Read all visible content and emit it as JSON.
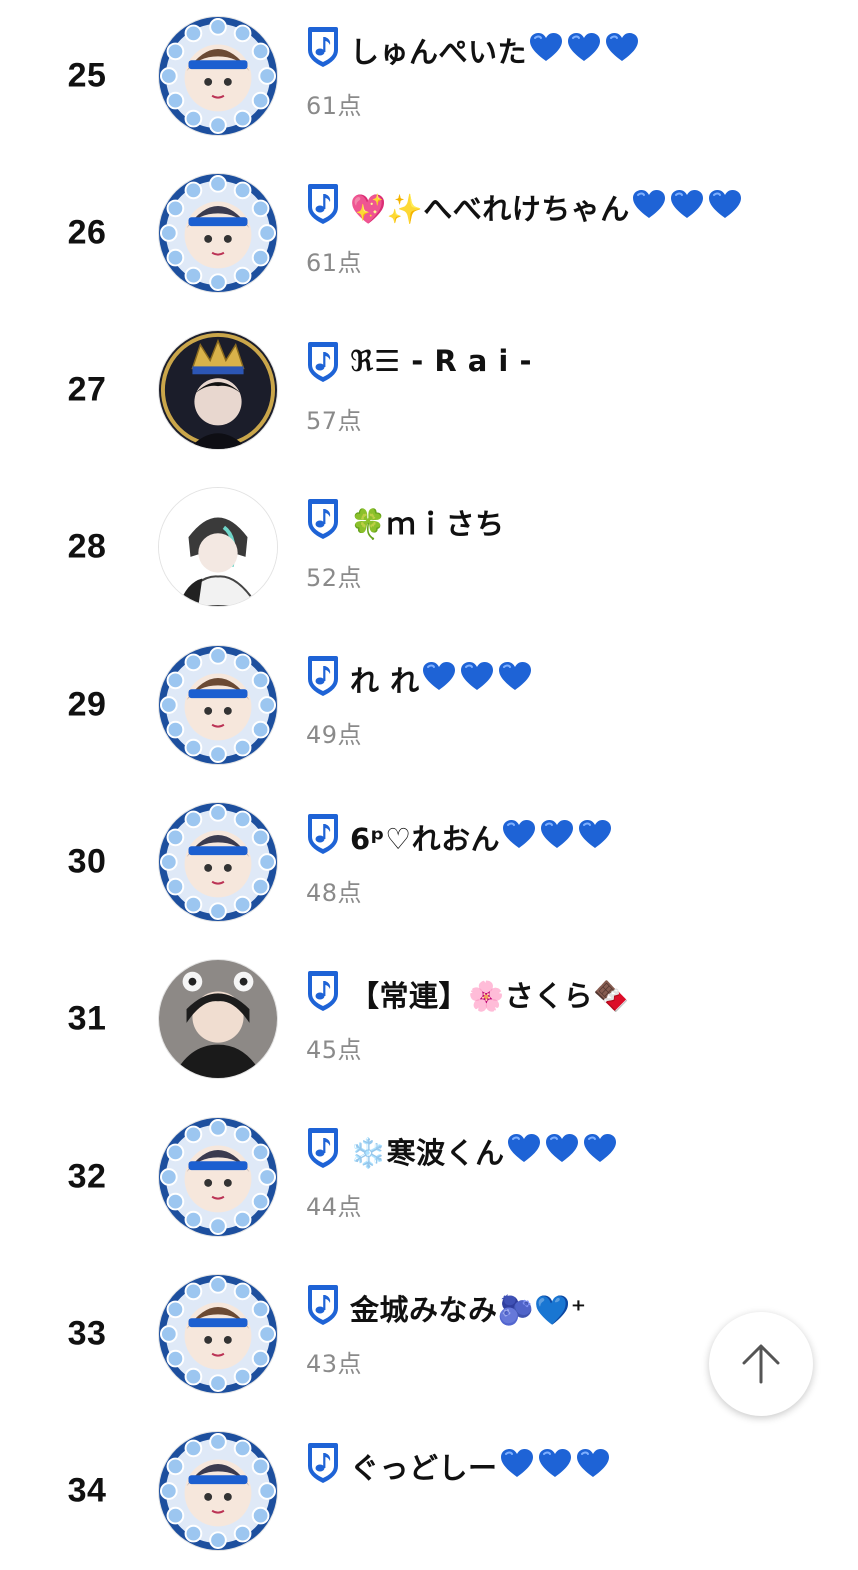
{
  "ranking": [
    {
      "rank": "25",
      "name": "しゅんぺいた",
      "score": "61点",
      "hearts": 3,
      "avatar": "blue-wreath"
    },
    {
      "rank": "26",
      "name": "💖✨へべれけちゃん",
      "score": "61点",
      "hearts": 3,
      "avatar": "blue-wreath"
    },
    {
      "rank": "27",
      "name": "ℜ☰ - R a i -",
      "score": "57点",
      "hearts": 0,
      "avatar": "crown-dark"
    },
    {
      "rank": "28",
      "name": "🍀ｍｉさち",
      "score": "52点",
      "hearts": 0,
      "avatar": "plain"
    },
    {
      "rank": "29",
      "name": "れ れ",
      "score": "49点",
      "hearts": 3,
      "avatar": "blue-wreath"
    },
    {
      "rank": "30",
      "name": "6ᵖ♡れおん",
      "score": "48点",
      "hearts": 3,
      "avatar": "blue-wreath"
    },
    {
      "rank": "31",
      "name": "【常連】🌸さくら🍫",
      "score": "45点",
      "hearts": 0,
      "avatar": "photo"
    },
    {
      "rank": "32",
      "name": "❄️寒波くん",
      "score": "44点",
      "hearts": 3,
      "avatar": "blue-wreath"
    },
    {
      "rank": "33",
      "name": "金城みなみ🫐💙⁺",
      "score": "43点",
      "hearts": 0,
      "avatar": "blue-wreath"
    },
    {
      "rank": "34",
      "name": "ぐっどしー",
      "score": "",
      "hearts": 3,
      "avatar": "blue-wreath"
    }
  ],
  "colors": {
    "badge": "#1e63d6",
    "heart": "#1e63d6",
    "score": "#8a8a8a"
  },
  "icons": {
    "badge": "music-note-shield-icon",
    "heart": "blue-heart-icon",
    "scroll_top": "arrow-up-icon"
  }
}
